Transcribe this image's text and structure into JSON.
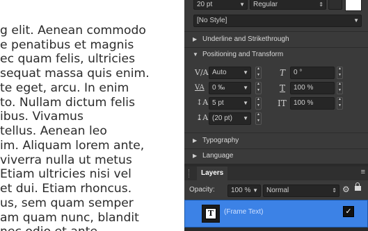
{
  "canvas": {
    "lines": [
      "g elit. Aenean commodo",
      "e penatibus et magnis",
      "ec quam felis, ultricies",
      "sequat massa quis enim.",
      "te eget, arcu. In enim",
      "to. Nullam dictum felis",
      "ibus. Vivamus",
      " tellus. Aenean leo",
      "im. Aliquam lorem ante,",
      " viverra nulla ut metus",
      " Etiam ultricies nisi vel",
      "et dui. Etiam rhoncus.",
      "us, sem quam semper",
      "am quam nunc, blandit",
      "nec odio et ante"
    ]
  },
  "char_panel": {
    "font_size": "20 pt",
    "font_weight": "Regular",
    "style_value": "[No Style]",
    "section_underline": "Underline and Strikethrough",
    "section_positioning": "Positioning and Transform",
    "tracking_value": "Auto",
    "kerning_value": "0 ‰",
    "baseline_value": "5 pt",
    "leading_value": "(20 pt)",
    "shear_value": "0 °",
    "scale_v_value": "100 %",
    "scale_h_value": "100 %",
    "section_typography": "Typography",
    "section_language": "Language"
  },
  "layers_panel": {
    "tab_label": "Layers",
    "opacity_label": "Opacity:",
    "opacity_value": "100 %",
    "blend_mode": "Normal",
    "layer_name": "(Frame Text)",
    "layer_thumb_glyph": "T",
    "checkbox_glyph": "✓",
    "selection_color": "#3c82e6"
  }
}
